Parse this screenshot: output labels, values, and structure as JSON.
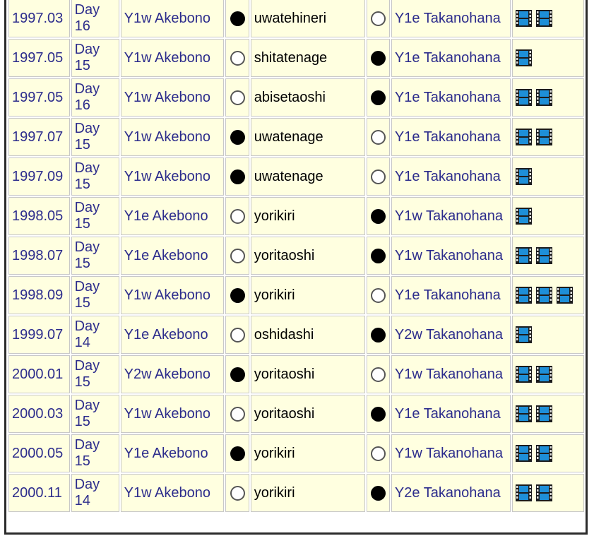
{
  "rows": [
    {
      "date": "1997.03",
      "day_label": "Day",
      "day_num": "16",
      "left": "Y1w Akebono",
      "left_result": "win",
      "kimarite": "uwatehineri",
      "right_result": "loss",
      "right": "Y1e Takanohana",
      "films": 2
    },
    {
      "date": "1997.05",
      "day_label": "Day",
      "day_num": "15",
      "left": "Y1w Akebono",
      "left_result": "loss",
      "kimarite": "shitatenage",
      "right_result": "win",
      "right": "Y1e Takanohana",
      "films": 1
    },
    {
      "date": "1997.05",
      "day_label": "Day",
      "day_num": "16",
      "left": "Y1w Akebono",
      "left_result": "loss",
      "kimarite": "abisetaoshi",
      "right_result": "win",
      "right": "Y1e Takanohana",
      "films": 2
    },
    {
      "date": "1997.07",
      "day_label": "Day",
      "day_num": "15",
      "left": "Y1w Akebono",
      "left_result": "win",
      "kimarite": "uwatenage",
      "right_result": "loss",
      "right": "Y1e Takanohana",
      "films": 2
    },
    {
      "date": "1997.09",
      "day_label": "Day",
      "day_num": "15",
      "left": "Y1w Akebono",
      "left_result": "win",
      "kimarite": "uwatenage",
      "right_result": "loss",
      "right": "Y1e Takanohana",
      "films": 1
    },
    {
      "date": "1998.05",
      "day_label": "Day",
      "day_num": "15",
      "left": "Y1e Akebono",
      "left_result": "loss",
      "kimarite": "yorikiri",
      "right_result": "win",
      "right": "Y1w Takanohana",
      "films": 1
    },
    {
      "date": "1998.07",
      "day_label": "Day",
      "day_num": "15",
      "left": "Y1e Akebono",
      "left_result": "loss",
      "kimarite": "yoritaoshi",
      "right_result": "win",
      "right": "Y1w Takanohana",
      "films": 2
    },
    {
      "date": "1998.09",
      "day_label": "Day",
      "day_num": "15",
      "left": "Y1w Akebono",
      "left_result": "win",
      "kimarite": "yorikiri",
      "right_result": "loss",
      "right": "Y1e Takanohana",
      "films": 3
    },
    {
      "date": "1999.07",
      "day_label": "Day",
      "day_num": "14",
      "left": "Y1e Akebono",
      "left_result": "loss",
      "kimarite": "oshidashi",
      "right_result": "win",
      "right": "Y2w Takanohana",
      "films": 1
    },
    {
      "date": "2000.01",
      "day_label": "Day",
      "day_num": "15",
      "left": "Y2w Akebono",
      "left_result": "win",
      "kimarite": "yoritaoshi",
      "right_result": "loss",
      "right": "Y1w Takanohana",
      "films": 2
    },
    {
      "date": "2000.03",
      "day_label": "Day",
      "day_num": "15",
      "left": "Y1w Akebono",
      "left_result": "loss",
      "kimarite": "yoritaoshi",
      "right_result": "win",
      "right": "Y1e Takanohana",
      "films": 2
    },
    {
      "date": "2000.05",
      "day_label": "Day",
      "day_num": "15",
      "left": "Y1e Akebono",
      "left_result": "win",
      "kimarite": "yorikiri",
      "right_result": "loss",
      "right": "Y1w Takanohana",
      "films": 2
    },
    {
      "date": "2000.11",
      "day_label": "Day",
      "day_num": "14",
      "left": "Y1w Akebono",
      "left_result": "loss",
      "kimarite": "yorikiri",
      "right_result": "win",
      "right": "Y2e Takanohana",
      "films": 2
    }
  ],
  "icons": {
    "win": "black-circle-icon",
    "loss": "white-circle-icon",
    "film": "film-icon"
  },
  "colors": {
    "cell_bg": "#ffffe0",
    "link": "#2c2c8c",
    "film_blue": "#1e8fd8"
  }
}
